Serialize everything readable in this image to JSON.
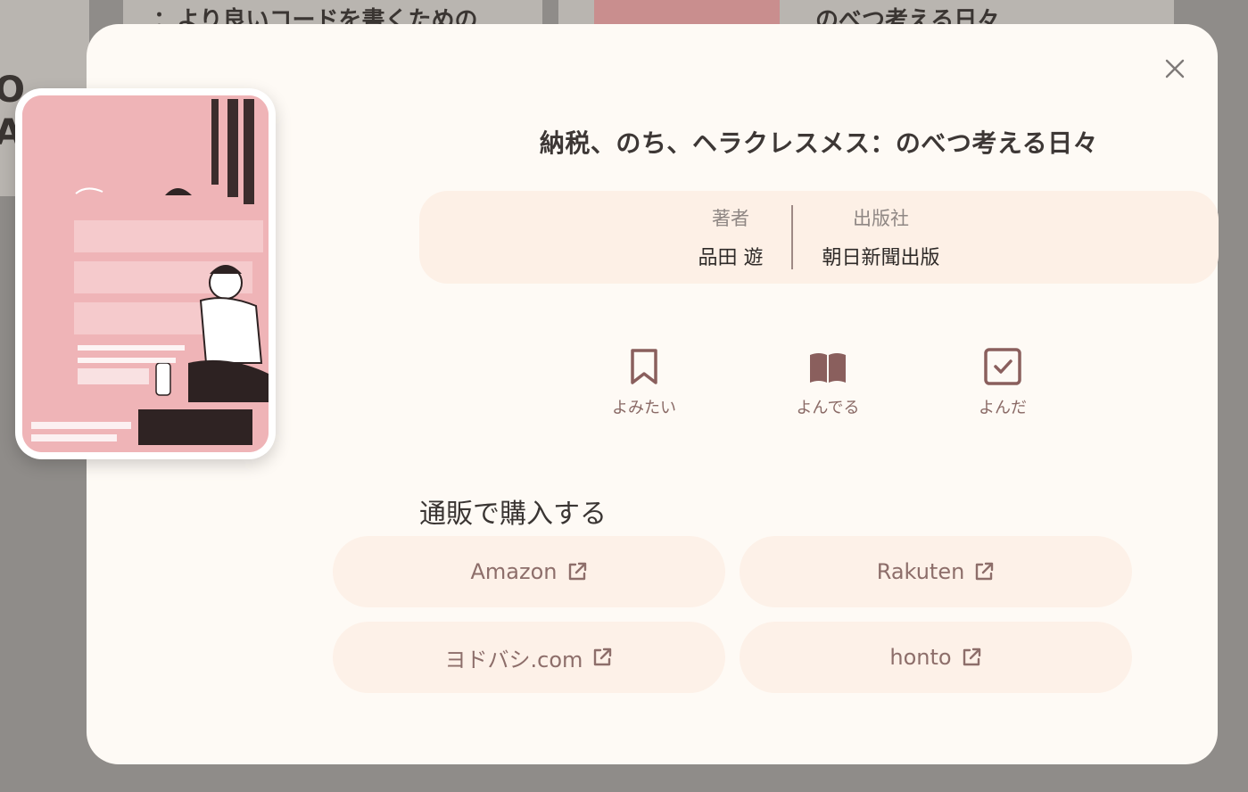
{
  "background": {
    "title_left": "：より良いコードを書くための",
    "title_right": "のべつ考える日々",
    "edge_top": "O",
    "edge_bottom": "A"
  },
  "modal": {
    "close_icon": "close-icon",
    "book": {
      "title": "納税、のち、ヘラクレスメス：のべつ考える日々",
      "cover_alt_title": "納税、のち、ヘラクレスメス のべつ考える日々",
      "cover_author": "品田遊"
    },
    "meta": {
      "author_label": "著者",
      "author_value": "品田 遊",
      "publisher_label": "出版社",
      "publisher_value": "朝日新聞出版"
    },
    "status": [
      {
        "label": "よみたい",
        "icon": "bookmark-icon"
      },
      {
        "label": "よんでる",
        "icon": "open-book-icon"
      },
      {
        "label": "よんだ",
        "icon": "checkbox-icon"
      }
    ],
    "purchase": {
      "heading": "通販で購入する",
      "shops": [
        {
          "label": "Amazon",
          "icon": "external-link-icon"
        },
        {
          "label": "Rakuten",
          "icon": "external-link-icon"
        },
        {
          "label": "ヨドバシ.com",
          "icon": "external-link-icon"
        },
        {
          "label": "honto",
          "icon": "external-link-icon"
        }
      ]
    }
  },
  "colors": {
    "modal_bg": "#fefaf5",
    "panel_bg": "#fdf0e6",
    "accent": "#8a6a66",
    "cover_pink": "#efb4b7"
  }
}
